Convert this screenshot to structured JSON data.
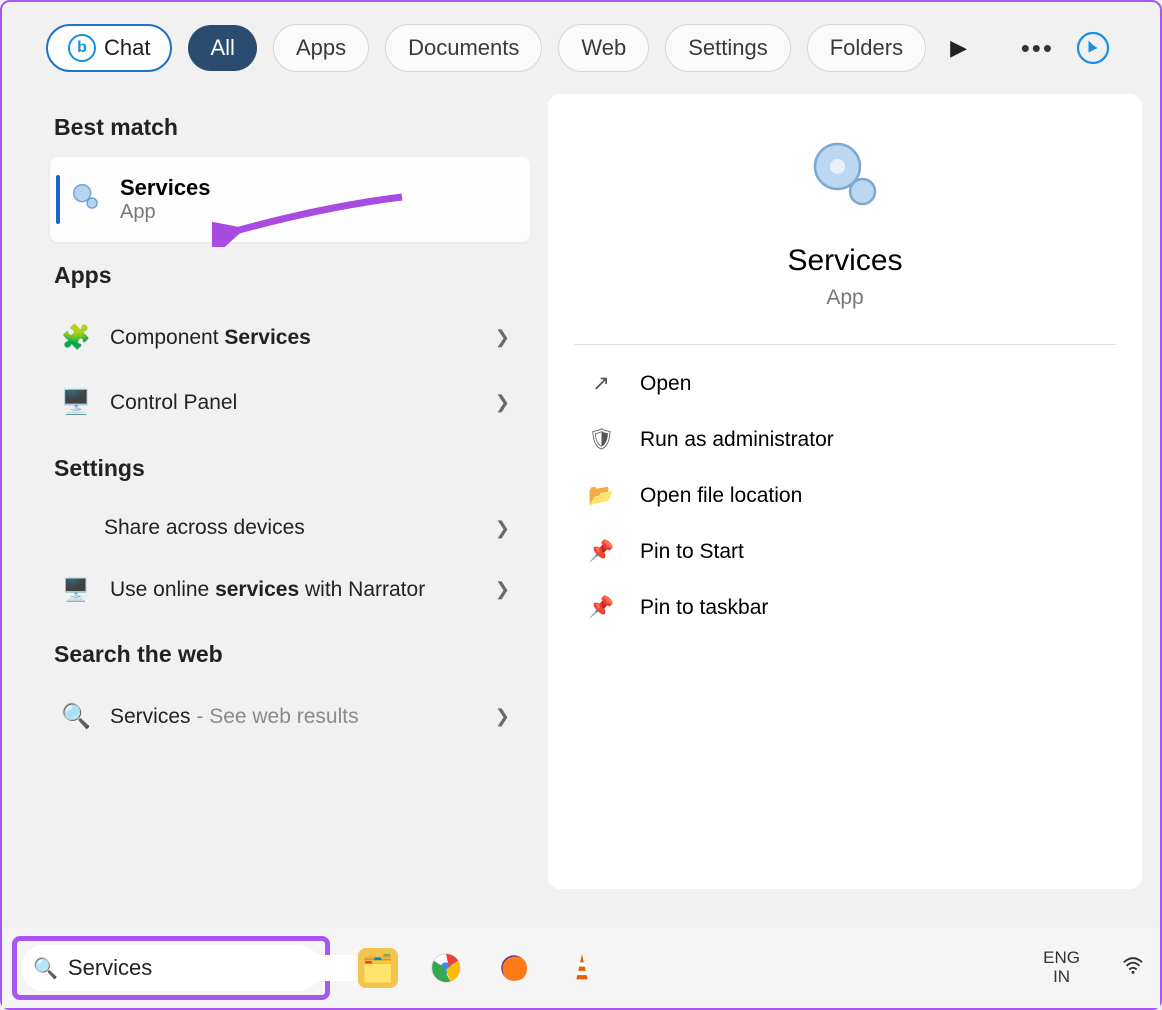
{
  "tabs": {
    "chat": "Chat",
    "all": "All",
    "apps": "Apps",
    "documents": "Documents",
    "web": "Web",
    "settings": "Settings",
    "folders": "Folders"
  },
  "sections": {
    "best_match": "Best match",
    "apps": "Apps",
    "settings": "Settings",
    "search_web": "Search the web"
  },
  "best_match": {
    "title": "Services",
    "subtitle": "App"
  },
  "apps_list": [
    {
      "prefix": "Component ",
      "bold": "Services"
    },
    {
      "prefix": "Control Panel",
      "bold": ""
    }
  ],
  "settings_list": [
    {
      "text": "Share across devices"
    },
    {
      "pre": "Use online ",
      "bold": "services",
      "post": " with Narrator"
    }
  ],
  "web_row": {
    "term": "Services",
    "suffix": " - See web results"
  },
  "preview": {
    "title": "Services",
    "subtitle": "App",
    "actions": {
      "open": "Open",
      "admin": "Run as administrator",
      "location": "Open file location",
      "pin_start": "Pin to Start",
      "pin_taskbar": "Pin to taskbar"
    }
  },
  "taskbar": {
    "search_value": "Services",
    "lang_primary": "ENG",
    "lang_secondary": "IN"
  }
}
